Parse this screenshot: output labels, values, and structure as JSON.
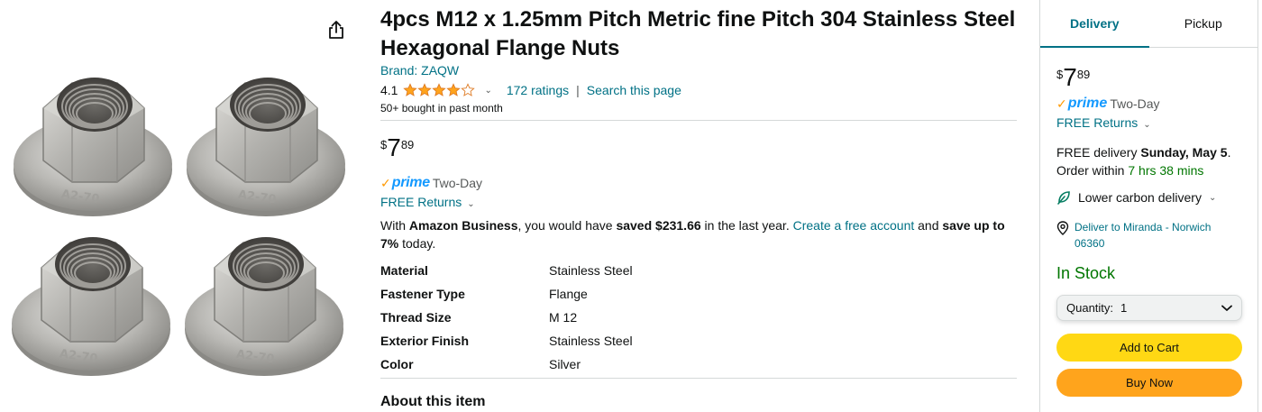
{
  "product": {
    "title": "4pcs M12 x 1.25mm Pitch Metric fine Pitch 304 Stainless Steel Hexagonal Flange Nuts",
    "brand": "Brand: ZAQW",
    "rating": "4.1",
    "rating_stars": 4.1,
    "ratings_count": "172 ratings",
    "search_page": "Search this page",
    "separator": "|",
    "bought": "50+ bought in past month",
    "price": {
      "symbol": "$",
      "whole": "7",
      "fraction": "89"
    },
    "prime_label": "prime",
    "two_day": "Two-Day",
    "free_returns": "FREE Returns",
    "business": {
      "prefix": "With ",
      "amazon_business": "Amazon Business",
      "middle": ", you would have ",
      "saved": "saved $231.66",
      "middle2": " in the last year. ",
      "create_link": "Create a free account",
      "and": " and ",
      "save_up": "save up to 7%",
      "suffix": " today."
    },
    "specs": [
      {
        "key": "Material",
        "value": "Stainless Steel"
      },
      {
        "key": "Fastener Type",
        "value": "Flange"
      },
      {
        "key": "Thread Size",
        "value": "M 12"
      },
      {
        "key": "Exterior Finish",
        "value": "Stainless Steel"
      },
      {
        "key": "Color",
        "value": "Silver"
      }
    ],
    "about": "About this item",
    "nut_marking": "A2-70"
  },
  "buybox": {
    "tabs": [
      {
        "label": "Delivery",
        "active": true
      },
      {
        "label": "Pickup",
        "active": false
      }
    ],
    "price": {
      "symbol": "$",
      "whole": "7",
      "fraction": "89"
    },
    "prime_label": "prime",
    "two_day": "Two-Day",
    "free_returns": "FREE Returns",
    "delivery_prefix": "FREE delivery ",
    "delivery_date": "Sunday, May 5",
    "delivery_period": ".",
    "order_within": "Order within ",
    "countdown": "7 hrs 38 mins",
    "carbon": "Lower carbon delivery",
    "deliver_to": "Deliver to Miranda - Norwich 06360",
    "in_stock": "In Stock",
    "quantity_label": "Quantity:",
    "quantity_value": "1",
    "add_to_cart": "Add to Cart",
    "buy_now": "Buy Now"
  },
  "colors": {
    "link": "#007185",
    "star": "#ffa41c",
    "add_to_cart": "#ffd814",
    "buy_now": "#ffa41c",
    "in_stock": "#007600",
    "prime_blue": "#1399ff"
  },
  "icons": [
    "share-icon",
    "star-icon",
    "chevron-down-icon",
    "leaf-icon",
    "location-pin-icon"
  ]
}
